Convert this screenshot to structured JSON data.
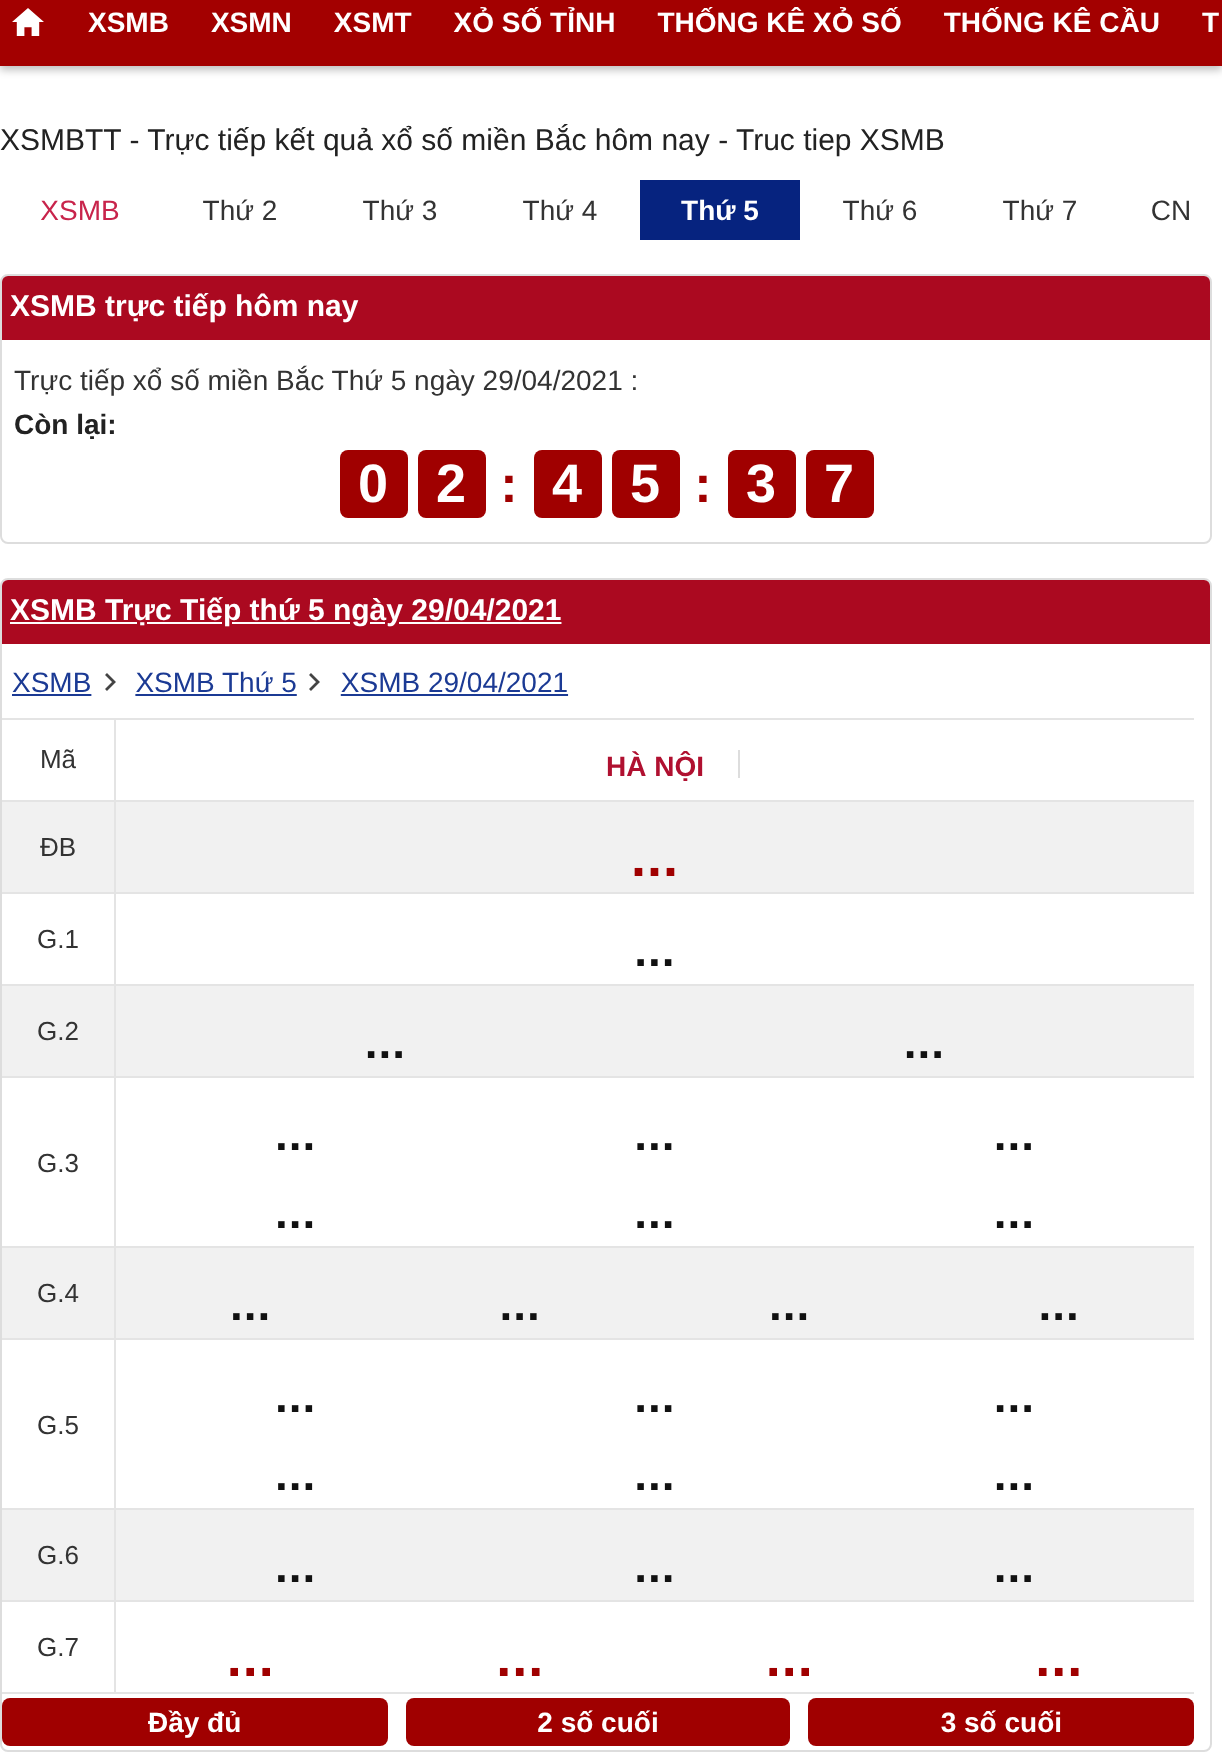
{
  "nav": [
    "XSMB",
    "XSMN",
    "XSMT",
    "XỎ SỐ TỈNH",
    "THỐNG KÊ XỎ SỐ",
    "THỐNG KÊ CẦU",
    "T"
  ],
  "page_title": "XSMBTT - Trực tiếp kết quả xổ số miền Bắc hôm nay - Truc tiep XSMB",
  "tabs": [
    {
      "label": "XSMB",
      "kind": "region",
      "selected": false
    },
    {
      "label": "Thứ 2",
      "kind": "day",
      "selected": false
    },
    {
      "label": "Thứ 3",
      "kind": "day",
      "selected": false
    },
    {
      "label": "Thứ 4",
      "kind": "day",
      "selected": false
    },
    {
      "label": "Thứ 5",
      "kind": "day",
      "selected": true
    },
    {
      "label": "Thứ 6",
      "kind": "day",
      "selected": false
    },
    {
      "label": "Thứ 7",
      "kind": "day",
      "selected": false
    },
    {
      "label": "CN",
      "kind": "day",
      "selected": false
    }
  ],
  "live_card": {
    "title": "XSMB trực tiếp hôm nay",
    "text": "Trực tiếp xổ số miền Bắc Thứ 5 ngày 29/04/2021 :",
    "remaining_label": "Còn lại:",
    "countdown": [
      {
        "kind": "digit",
        "text": "0"
      },
      {
        "kind": "digit",
        "text": "2"
      },
      {
        "kind": "separator",
        "text": ":"
      },
      {
        "kind": "digit",
        "text": "4"
      },
      {
        "kind": "digit",
        "text": "5"
      },
      {
        "kind": "separator",
        "text": ":"
      },
      {
        "kind": "digit",
        "text": "3"
      },
      {
        "kind": "digit",
        "text": "7"
      }
    ]
  },
  "results": {
    "title": "XSMB Trực Tiếp thứ 5 ngày 29/04/2021",
    "breadcrumb": [
      "XSMB",
      "XSMB Thứ 5",
      "XSMB 29/04/2021"
    ],
    "columns": [
      "Mã",
      "HÀ NỘI"
    ],
    "rows": [
      {
        "label": "ĐB",
        "highlight": true,
        "lines": [
          [
            "..."
          ]
        ]
      },
      {
        "label": "G.1",
        "highlight": false,
        "lines": [
          [
            "..."
          ]
        ]
      },
      {
        "label": "G.2",
        "highlight": false,
        "lines": [
          [
            "...",
            "..."
          ]
        ]
      },
      {
        "label": "G.3",
        "highlight": false,
        "lines": [
          [
            "...",
            "...",
            "..."
          ],
          [
            "...",
            "...",
            "..."
          ]
        ]
      },
      {
        "label": "G.4",
        "highlight": false,
        "lines": [
          [
            "...",
            "...",
            "...",
            "..."
          ]
        ]
      },
      {
        "label": "G.5",
        "highlight": false,
        "lines": [
          [
            "...",
            "...",
            "..."
          ],
          [
            "...",
            "...",
            "..."
          ]
        ]
      },
      {
        "label": "G.6",
        "highlight": false,
        "lines": [
          [
            "...",
            "...",
            "..."
          ]
        ]
      },
      {
        "label": "G.7",
        "highlight": true,
        "lines": [
          [
            "...",
            "...",
            "...",
            "..."
          ]
        ]
      }
    ],
    "buttons": [
      "Đầy đủ",
      "2 số cuối",
      "3 số cuối"
    ]
  }
}
